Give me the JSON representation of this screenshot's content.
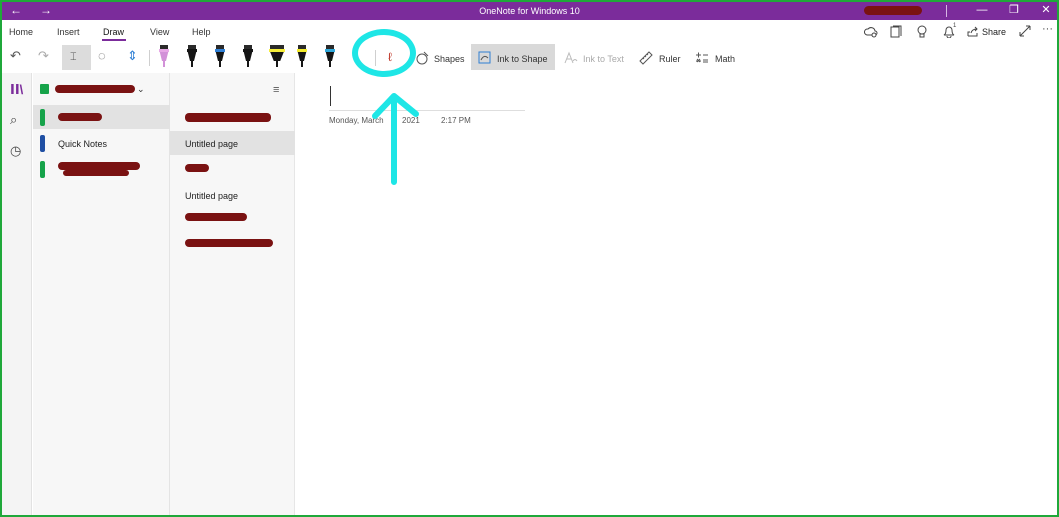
{
  "titlebar": {
    "title": "OneNote for Windows 10",
    "back_icon": "←",
    "forward_icon": "→",
    "minimize_icon": "—",
    "restore_icon": "❐",
    "close_icon": "✕"
  },
  "menu": {
    "tabs": [
      {
        "label": "Home"
      },
      {
        "label": "Insert"
      },
      {
        "label": "Draw",
        "active": true
      },
      {
        "label": "View"
      },
      {
        "label": "Help"
      }
    ],
    "share_label": "Share",
    "notification_count": "1",
    "more_icon": "···"
  },
  "toolbar": {
    "undo_icon": "↶",
    "redo_icon": "↷",
    "select_icon": "⌶",
    "lasso_add_icon": "◌",
    "insert_space_icon": "⇕",
    "pens": [
      {
        "band": "#e7a7e6",
        "tip": "#d291d8"
      },
      {
        "band": "#151515",
        "tip": "#151515"
      },
      {
        "band": "#2f7fd4",
        "tip": "#151515"
      },
      {
        "band": "#151515",
        "tip": "#151515"
      },
      {
        "band": "#f6ee3a",
        "tip": "#151515"
      },
      {
        "band": "#f4ec2a",
        "tip": "#151515"
      },
      {
        "band": "#2fa7d9",
        "tip": "#151515"
      },
      {
        "band": "#151515",
        "tip": "#151515"
      }
    ],
    "lasso_icon": "ℓ",
    "shapes_label": "Shapes",
    "ink_to_shape_label": "Ink to Shape",
    "ink_to_text_label": "Ink to Text",
    "ruler_label": "Ruler",
    "math_label": "Math"
  },
  "annotation": {
    "color": "#1ee6e6"
  },
  "sections": {
    "items": [
      {
        "label": "",
        "color": "#16a34a",
        "redacted": true,
        "selected": true
      },
      {
        "label": "Quick Notes",
        "color": "#1f4fa3",
        "redacted": false,
        "selected": false
      },
      {
        "label": "",
        "color": "#16a34a",
        "redacted": true,
        "selected": false
      }
    ]
  },
  "pages": {
    "items": [
      {
        "label": "",
        "redacted": true,
        "selected": false
      },
      {
        "label": "Untitled page",
        "redacted": false,
        "selected": true
      },
      {
        "label": "",
        "redacted": true,
        "selected": false
      },
      {
        "label": "Untitled page",
        "redacted": false,
        "selected": false
      },
      {
        "label": "",
        "redacted": true,
        "selected": false
      },
      {
        "label": "",
        "redacted": true,
        "selected": false
      }
    ]
  },
  "canvas": {
    "date": "Monday, March",
    "year": "2021",
    "time": "2:17 PM"
  }
}
